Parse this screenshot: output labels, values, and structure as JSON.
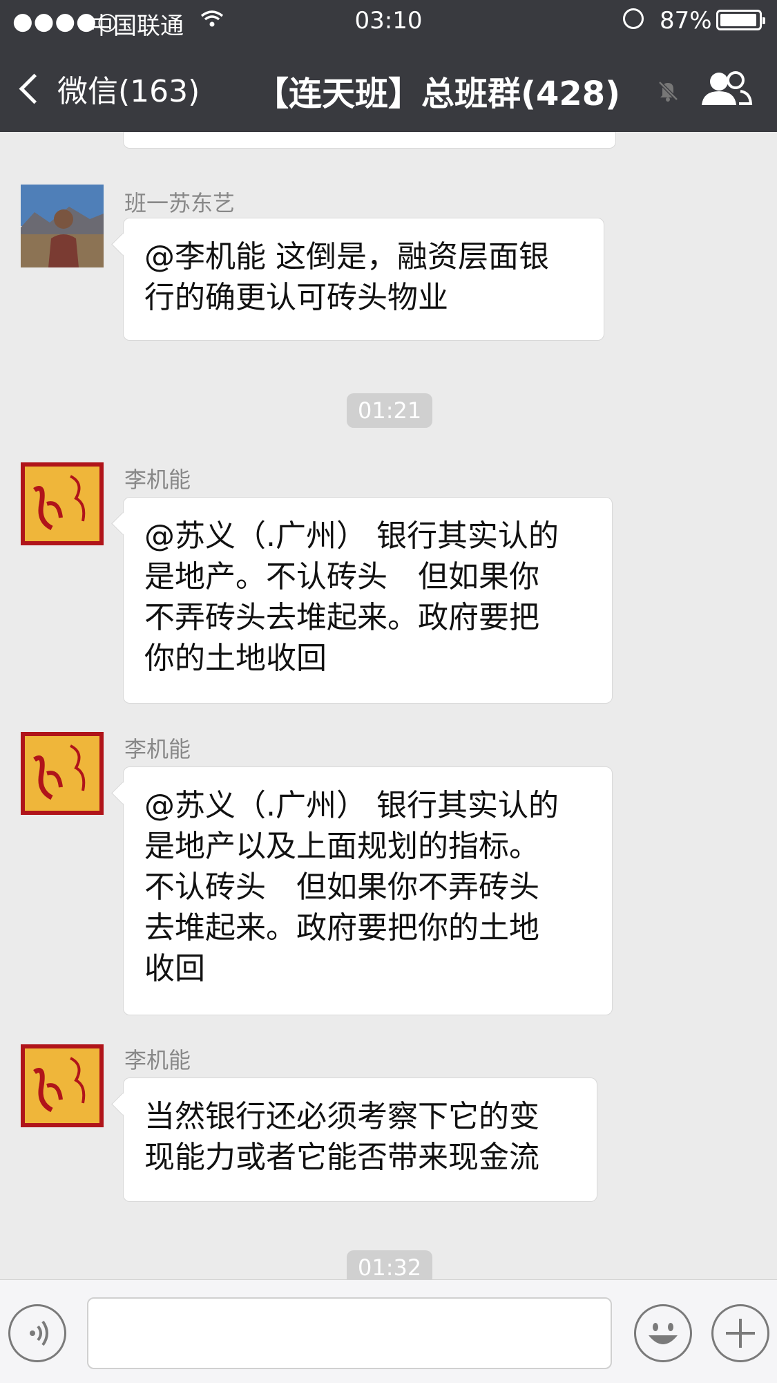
{
  "status_bar": {
    "signal": "●●●●○",
    "carrier": "中国联通",
    "time": "03:10",
    "battery": "87%"
  },
  "nav": {
    "back_label": "微信(163)",
    "title": "【连天班】总班群(428)"
  },
  "messages": [
    {
      "sender": "班一苏东艺",
      "lines": [
        "@李机能 这倒是，融资层面银",
        "行的确更认可砖头物业"
      ]
    },
    {
      "sender": "李机能",
      "lines": [
        "@苏义（.广州） 银行其实认的",
        "是地产。不认砖头　但如果你",
        "不弄砖头去堆起来。政府要把",
        "你的土地收回"
      ]
    },
    {
      "sender": "李机能",
      "lines": [
        "@苏义（.广州） 银行其实认的",
        "是地产以及上面规划的指标。",
        "不认砖头　但如果你不弄砖头",
        "去堆起来。政府要把你的土地",
        "收回"
      ]
    },
    {
      "sender": "李机能",
      "lines": [
        "当然银行还必须考察下它的变",
        "现能力或者它能否带来现金流"
      ]
    }
  ],
  "timestamps": [
    "01:21",
    "01:32"
  ],
  "icons": {
    "back": "chevron-left-icon",
    "mute": "bell-muted-icon",
    "group": "group-members-icon",
    "voice": "voice-input-icon",
    "emoji": "emoji-icon",
    "more": "plus-icon"
  },
  "colors": {
    "nav_bg": "#393a3f",
    "chat_bg": "#ebebeb",
    "bubble_bg": "#ffffff",
    "time_chip_bg": "#d0d0d0"
  }
}
